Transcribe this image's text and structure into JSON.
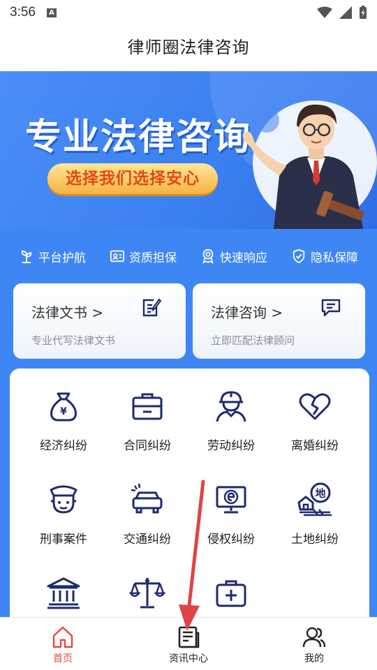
{
  "status_bar": {
    "time": "3:56",
    "notification_letter": "A"
  },
  "header": {
    "title": "律师圈法律咨询"
  },
  "banner": {
    "title": "专业法律咨询",
    "slogan": "选择我们选择安心"
  },
  "features": [
    {
      "label": "平台护航",
      "icon": "sprout-icon"
    },
    {
      "label": "资质担保",
      "icon": "id-card-icon"
    },
    {
      "label": "快速响应",
      "icon": "medal-icon"
    },
    {
      "label": "隐私保障",
      "icon": "shield-check-icon"
    }
  ],
  "cards": [
    {
      "title": "法律文书 >",
      "subtitle": "专业代写法律文书",
      "icon": "document-edit-icon"
    },
    {
      "title": "法律咨询 >",
      "subtitle": "立即匹配法律顾问",
      "icon": "chat-bubble-icon"
    }
  ],
  "categories": [
    {
      "label": "经济纠纷",
      "icon": "money-bag-icon"
    },
    {
      "label": "合同纠纷",
      "icon": "briefcase-icon"
    },
    {
      "label": "劳动纠纷",
      "icon": "worker-icon"
    },
    {
      "label": "离婚纠纷",
      "icon": "broken-heart-icon"
    },
    {
      "label": "刑事案件",
      "icon": "police-icon"
    },
    {
      "label": "交通纠纷",
      "icon": "car-crash-icon"
    },
    {
      "label": "侵权纠纷",
      "icon": "monitor-icon"
    },
    {
      "label": "土地纠纷",
      "icon": "land-icon"
    },
    {
      "label": "",
      "icon": "court-building-icon"
    },
    {
      "label": "",
      "icon": "scales-icon"
    },
    {
      "label": "",
      "icon": "medical-kit-icon"
    }
  ],
  "tab_bar": {
    "items": [
      {
        "label": "首页",
        "icon": "home-icon",
        "active": true
      },
      {
        "label": "资讯中心",
        "icon": "news-icon",
        "active": false
      },
      {
        "label": "我的",
        "icon": "user-icon",
        "active": false
      }
    ]
  },
  "colors": {
    "primary_blue": "#3f86f5",
    "icon_navy": "#1e2a6e",
    "accent_red": "#e24a3a",
    "pill_text": "#e24a12"
  }
}
